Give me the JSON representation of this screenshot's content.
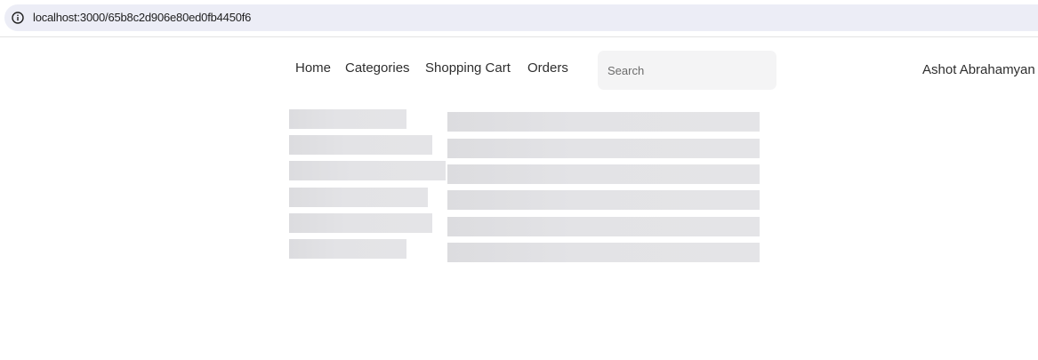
{
  "browser": {
    "url": "localhost:3000/65b8c2d906e80ed0fb4450f6",
    "info_icon": "info-circle-icon"
  },
  "nav": {
    "items": [
      {
        "label": "Home"
      },
      {
        "label": "Categories"
      },
      {
        "label": "Shopping Cart"
      },
      {
        "label": "Orders"
      }
    ]
  },
  "search": {
    "placeholder": "Search",
    "value": ""
  },
  "user": {
    "name": "Ashot Abrahamyan"
  },
  "loading": {
    "sidebar_placeholder_count": 6,
    "main_placeholder_count": 6,
    "skeleton_color": "#e2e2e5"
  }
}
